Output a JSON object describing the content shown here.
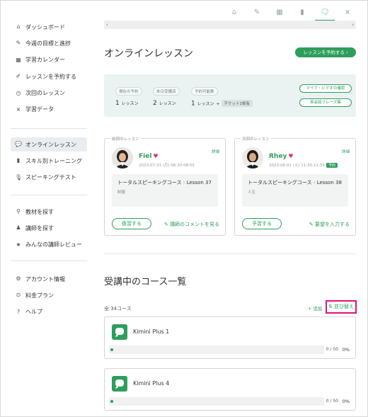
{
  "sidebar": {
    "group1": [
      {
        "label": "ダッシュボード",
        "icon": "home-icon",
        "glyph": "⌂"
      },
      {
        "label": "今週の目標と進捗",
        "icon": "pencil-icon",
        "glyph": "✎"
      },
      {
        "label": "学習カレンダー",
        "icon": "calendar-icon",
        "glyph": "▦"
      },
      {
        "label": "レッスンを予約する",
        "icon": "edit-icon",
        "glyph": "✐"
      },
      {
        "label": "次回のレッスン",
        "icon": "clock-icon",
        "glyph": "◷"
      },
      {
        "label": "学習データ",
        "icon": "chart-icon",
        "glyph": "⩙"
      }
    ],
    "group2": [
      {
        "label": "オンラインレッスン",
        "icon": "chat-icon",
        "glyph": "💬"
      },
      {
        "label": "スキル別トレーニング",
        "icon": "book-icon",
        "glyph": "▮"
      },
      {
        "label": "スピーキングテスト",
        "icon": "mic-icon",
        "glyph": "🎙"
      }
    ],
    "group3": [
      {
        "label": "教材を探す",
        "icon": "search-icon",
        "glyph": "⚲"
      },
      {
        "label": "講師を探す",
        "icon": "user-search-icon",
        "glyph": "♟"
      },
      {
        "label": "みんなの講師レビュー",
        "icon": "star-icon",
        "glyph": "★"
      }
    ],
    "group4": [
      {
        "label": "アカウント情報",
        "icon": "gear-icon",
        "glyph": "⚙"
      },
      {
        "label": "料金プラン",
        "icon": "yen-icon",
        "glyph": "⊙"
      },
      {
        "label": "ヘルプ",
        "icon": "help-icon",
        "glyph": "?"
      }
    ]
  },
  "topnav": [
    {
      "name": "home-icon",
      "glyph": "⌂"
    },
    {
      "name": "pencil-icon",
      "glyph": "✎"
    },
    {
      "name": "calendar-icon",
      "glyph": "▦"
    },
    {
      "name": "book-icon",
      "glyph": "▮"
    },
    {
      "name": "chat-icon",
      "glyph": "🗨"
    },
    {
      "name": "chart-icon",
      "glyph": "⩙"
    }
  ],
  "scroll": {
    "left": "‹",
    "right": "›"
  },
  "page": {
    "title": "オンラインレッスン",
    "reserve_button": "レッスンを予約する ›"
  },
  "stats": {
    "reserved_label": "現在の予約",
    "reserved_value": "1",
    "reserved_unit": "レッスン",
    "today_label": "本日受講済",
    "today_value": "2",
    "today_unit": "レッスン",
    "available_label": "予約可能数",
    "available_value": "1",
    "available_unit": "レッスン",
    "plus": "+",
    "ticket": "チケット1枚有",
    "mic_check": "マイク・ビデオの確認",
    "phrases": "英会話フレーズ集"
  },
  "previous": {
    "legend": "前回のレッスン",
    "name": "Fiel",
    "datetime": "2023-07-31 (月) 08:30-08:55",
    "detail": "詳細",
    "course": "トータルスピーキングコース",
    "arrow": "›",
    "lesson": "Lesson 37",
    "topic": "制服",
    "review_button": "復習する",
    "comment_link": "✎ 講師のコメントを見る"
  },
  "next": {
    "legend": "次回のレッスン",
    "name": "Rhey",
    "datetime": "2023-08-01 (火) 11:30-11:55",
    "badge": "予約",
    "detail": "詳細",
    "course": "トータルスピーキングコース",
    "arrow": "›",
    "lesson": "Lesson 38",
    "topic": "人生",
    "prepare_button": "予習する",
    "request_link": "✎ 要望を入力する"
  },
  "courses": {
    "title": "受講中のコース一覧",
    "count": "全 34コース",
    "add": "+ 追加",
    "sort": "⇅ 並び替え",
    "items": [
      {
        "name": "Kimini Plus 1",
        "progress": "0 / 50",
        "percent": "0%",
        "fraction": 0
      },
      {
        "name": "Kimini Plus 4",
        "progress": "0 / 50",
        "percent": "0%",
        "fraction": 0
      }
    ]
  },
  "colors": {
    "accent": "#2e9e5b",
    "highlight": "#e0117a",
    "heart": "#e0334f"
  }
}
